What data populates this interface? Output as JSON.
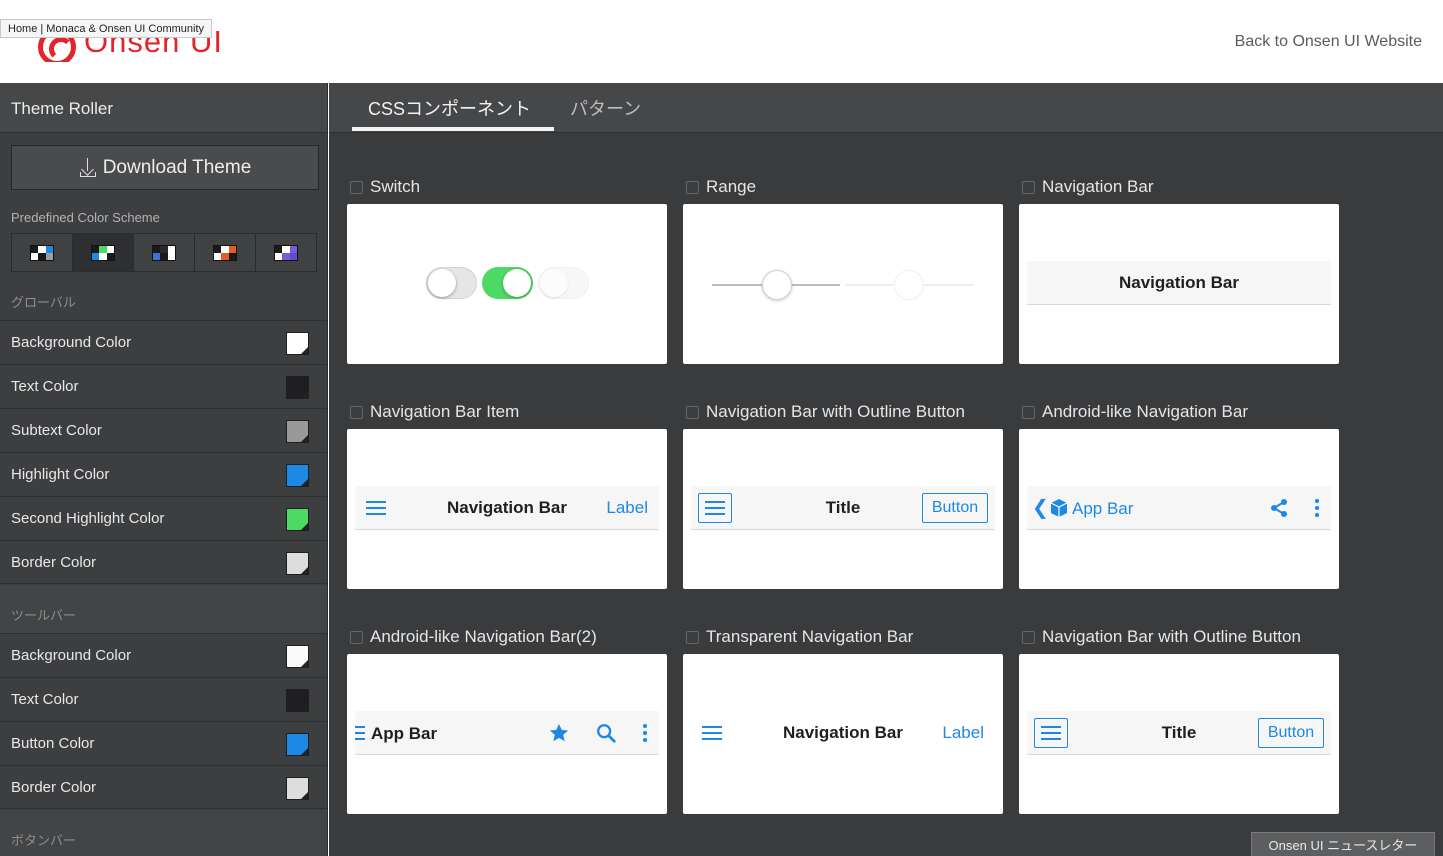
{
  "browser": {
    "tooltip": "Home | Monaca & Onsen UI Community"
  },
  "header": {
    "logo_text": "Onsen UI",
    "back_link": "Back to Onsen UI Website"
  },
  "sidebar": {
    "title": "Theme Roller",
    "download_label": "Download Theme",
    "scheme_label": "Predefined Color Scheme",
    "schemes": [
      {
        "name": "scheme-1",
        "colors": [
          "#1a1a1a",
          "#ffffff",
          "#1e88e5",
          "#ffffff",
          "#1a1a1a",
          "#9e9e9e"
        ]
      },
      {
        "name": "scheme-2",
        "colors": [
          "#1a1a1a",
          "#4cd964",
          "#ffffff",
          "#1e88e5",
          "#ffffff",
          "#1a1a1a"
        ]
      },
      {
        "name": "scheme-3",
        "colors": [
          "#1a1a1a",
          "#2a2a2a",
          "#ffffff",
          "#3f6fd8",
          "#1a1a1a",
          "#ffffff"
        ]
      },
      {
        "name": "scheme-4",
        "colors": [
          "#1a1a1a",
          "#ffffff",
          "#e85a2a",
          "#ffffff",
          "#e85a2a",
          "#1a1a1a"
        ]
      },
      {
        "name": "scheme-5",
        "colors": [
          "#1a1a1a",
          "#ffffff",
          "#7b5cd6",
          "#ffffff",
          "#7b5cd6",
          "#5f4bd0"
        ]
      }
    ],
    "global_label": "グローバル",
    "global_rows": [
      {
        "label": "Background Color",
        "color": "#ffffff"
      },
      {
        "label": "Text Color",
        "color": "#1f1f21"
      },
      {
        "label": "Subtext Color",
        "color": "#999999"
      },
      {
        "label": "Highlight Color",
        "color": "#1e88e5"
      },
      {
        "label": "Second Highlight Color",
        "color": "#4cd964"
      },
      {
        "label": "Border Color",
        "color": "#dddddd"
      }
    ],
    "toolbar_label": "ツールバー",
    "toolbar_rows": [
      {
        "label": "Background Color",
        "color": "#fafafa"
      },
      {
        "label": "Text Color",
        "color": "#1f1f21"
      },
      {
        "label": "Button Color",
        "color": "#1e88e5"
      },
      {
        "label": "Border Color",
        "color": "#dddddd"
      }
    ],
    "buttonbar_label": "ボタンバー"
  },
  "main": {
    "tabs": [
      "CSSコンポーネント",
      "パターン"
    ],
    "cards": [
      {
        "title": "Switch"
      },
      {
        "title": "Range"
      },
      {
        "title": "Navigation Bar",
        "nav_title": "Navigation Bar"
      },
      {
        "title": "Navigation Bar Item",
        "nav_title": "Navigation Bar",
        "right_label": "Label"
      },
      {
        "title": "Navigation Bar with Outline Button",
        "nav_title": "Title",
        "right_label": "Button"
      },
      {
        "title": "Android-like Navigation Bar",
        "nav_title": "App Bar"
      },
      {
        "title": "Android-like Navigation Bar(2)",
        "nav_title": "App Bar"
      },
      {
        "title": "Transparent Navigation Bar",
        "nav_title": "Navigation Bar",
        "right_label": "Label"
      },
      {
        "title": "Navigation Bar with Outline Button",
        "nav_title": "Title",
        "right_label": "Button"
      }
    ]
  },
  "newsletter": "Onsen UI ニュースレター",
  "colors": {
    "accent": "#1e88e5",
    "switch_on": "#4cd964",
    "brand": "#e4242b"
  }
}
